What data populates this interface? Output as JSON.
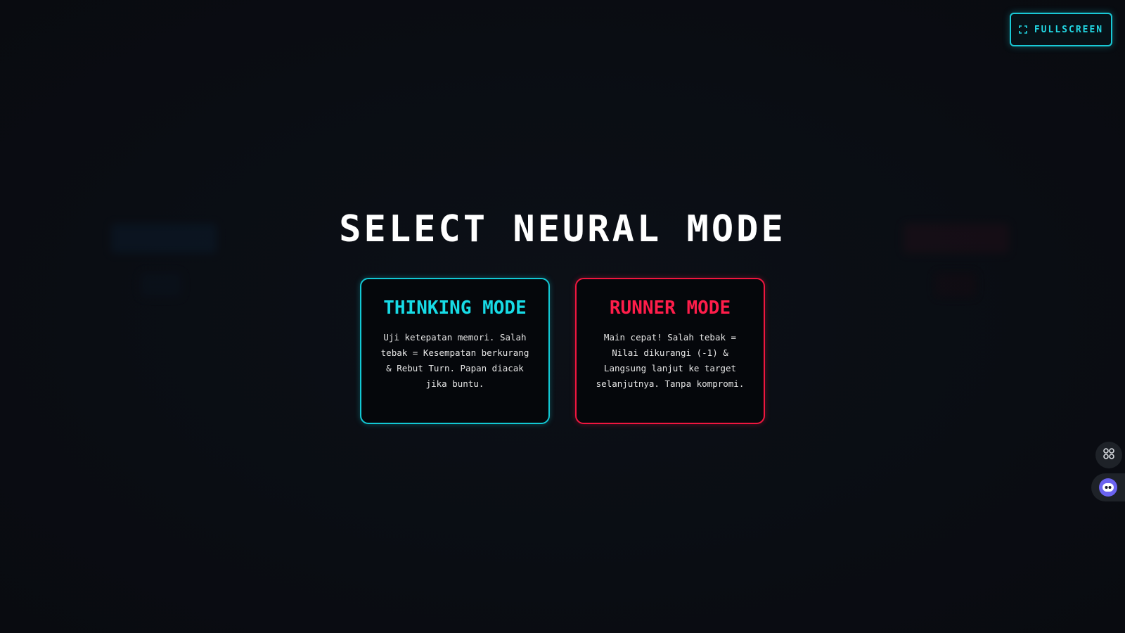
{
  "header": {
    "fullscreen_label": "FULLSCREEN",
    "fullscreen_icon": "expand-icon"
  },
  "main": {
    "title": "SELECT NEURAL MODE",
    "modes": [
      {
        "title": "THINKING MODE",
        "description": "Uji ketepatan memori. Salah tebak = Kesempatan berkurang & Rebut Turn. Papan diacak jika buntu.",
        "accent": "#17dbe6"
      },
      {
        "title": "RUNNER MODE",
        "description": "Main cepat! Salah tebak = Nilai dikurangi (-1) & Langsung lanjut ke target selanjutnya. Tanpa kompromi.",
        "accent": "#ff1d4a"
      }
    ]
  },
  "side_tools": {
    "grid_icon": "grid-icon",
    "assistant_icon": "bot-icon",
    "assistant_color": "#6b63f0"
  },
  "colors": {
    "background": "#0a0d13",
    "cyan": "#19c9d6",
    "red": "#f0163f"
  }
}
